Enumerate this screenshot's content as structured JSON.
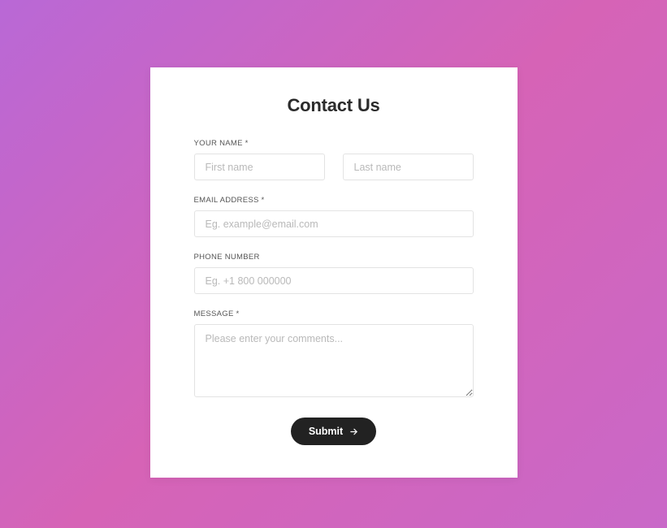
{
  "form": {
    "title": "Contact Us",
    "name_label": "YOUR NAME *",
    "first_name_placeholder": "First name",
    "last_name_placeholder": "Last name",
    "email_label": "EMAIL ADDRESS *",
    "email_placeholder": "Eg. example@email.com",
    "phone_label": "PHONE NUMBER",
    "phone_placeholder": "Eg. +1 800 000000",
    "message_label": "MESSAGE *",
    "message_placeholder": "Please enter your comments...",
    "submit_label": "Submit"
  }
}
